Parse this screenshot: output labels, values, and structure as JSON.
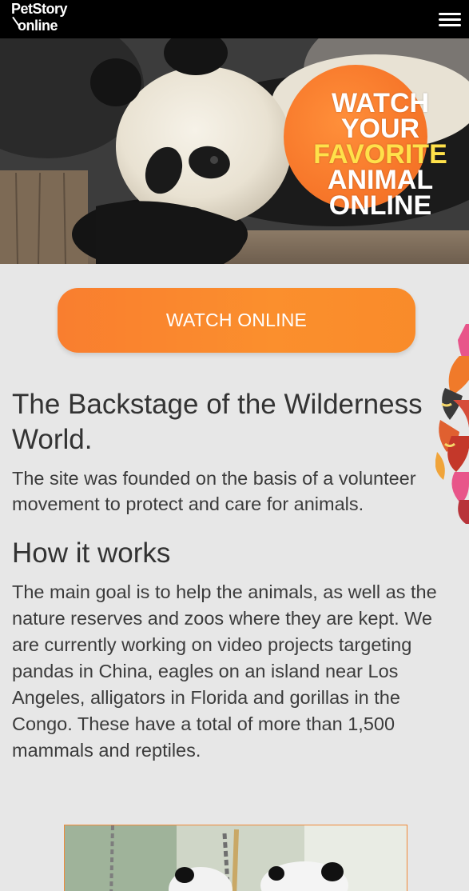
{
  "header": {
    "logo_line1": "PetStory",
    "logo_line2": "online",
    "menu_icon": "hamburger-menu-icon"
  },
  "hero": {
    "line1": "WATCH",
    "line2": "YOUR",
    "line3": "FAVORITE",
    "line4": "ANIMAL",
    "line5": "ONLINE"
  },
  "cta": {
    "label": "WATCH ONLINE"
  },
  "about": {
    "title": "The Backstage of the Wilderness World.",
    "text": "The site was founded on the basis of a volunteer movement to protect and care for animals."
  },
  "how": {
    "title": "How it works",
    "text": "The main goal is to help the animals, as well as the nature reserves and zoos where they are kept. We are currently working on video projects targeting pandas in China, eagles on an island near Los Angeles, alligators in Florida and gorillas in the Congo. These have a total of more than 1,500 mammals and reptiles."
  },
  "colors": {
    "accent_orange": "#f97e2f",
    "highlight_yellow": "#ffe14a",
    "header_bg": "#000000",
    "page_bg": "#e7e7e7"
  }
}
